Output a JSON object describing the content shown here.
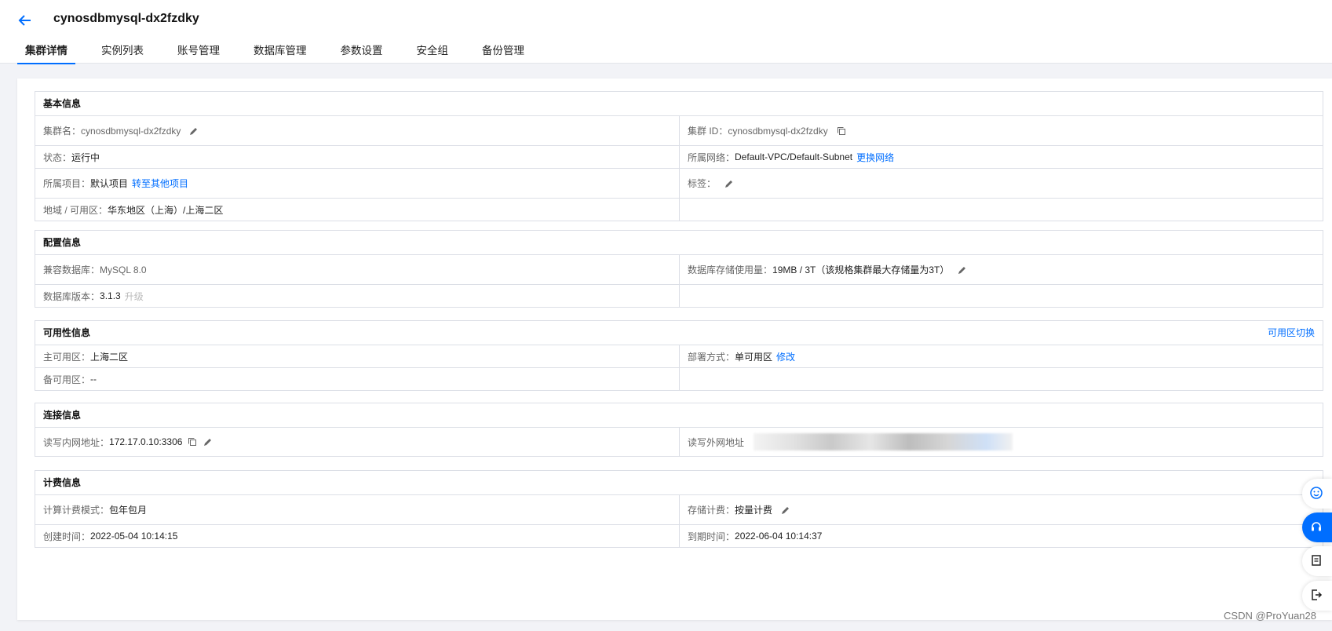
{
  "header": {
    "title": "cynosdbmysql-dx2fzdky"
  },
  "tabs": [
    {
      "label": "集群详情",
      "active": true
    },
    {
      "label": "实例列表"
    },
    {
      "label": "账号管理"
    },
    {
      "label": "数据库管理"
    },
    {
      "label": "参数设置"
    },
    {
      "label": "安全组"
    },
    {
      "label": "备份管理"
    }
  ],
  "basic": {
    "title": "基本信息",
    "cluster_name_label": "集群名：",
    "cluster_name": "cynosdbmysql-dx2fzdky",
    "cluster_id_label": "集群 ID：",
    "cluster_id": "cynosdbmysql-dx2fzdky",
    "status_label": "状态：",
    "status": "运行中",
    "network_label": "所属网络：",
    "network": "Default-VPC/Default-Subnet",
    "network_action": "更换网络",
    "project_label": "所属项目：",
    "project": "默认项目",
    "project_action": "转至其他项目",
    "tags_label": "标签：",
    "region_label": "地域 / 可用区：",
    "region": "华东地区（上海）/上海二区"
  },
  "config": {
    "title": "配置信息",
    "compat_label": "兼容数据库：",
    "compat": "MySQL 8.0",
    "storage_label": "数据库存储使用量：",
    "storage": "19MB / 3T（该规格集群最大存储量为3T）",
    "version_label": "数据库版本：",
    "version": "3.1.3",
    "upgrade": "升级"
  },
  "availability": {
    "title": "可用性信息",
    "action": "可用区切换",
    "primary_label": "主可用区：",
    "primary": "上海二区",
    "deploy_label": "部署方式：",
    "deploy": "单可用区",
    "deploy_action": "修改",
    "standby_label": "备可用区：",
    "standby": "--"
  },
  "connection": {
    "title": "连接信息",
    "rw_internal_label": "读写内网地址：",
    "rw_internal": "172.17.0.10:3306",
    "rw_external_label": "读写外网地址"
  },
  "billing": {
    "title": "计费信息",
    "compute_label": "计算计费模式：",
    "compute": "包年包月",
    "storage_label": "存储计费：",
    "storage": "按量计费",
    "created_label": "创建时间：",
    "created": "2022-05-04 10:14:15",
    "expire_label": "到期时间：",
    "expire": "2022-06-04 10:14:37"
  },
  "watermark": "CSDN @ProYuan28",
  "colors": {
    "accent": "#006eff",
    "border": "#dcdfe6",
    "background": "#f2f3f7"
  },
  "icons": [
    "arrow-left-icon",
    "pencil-icon",
    "copy-icon",
    "smile-icon",
    "headset-icon",
    "document-icon",
    "exit-icon"
  ]
}
